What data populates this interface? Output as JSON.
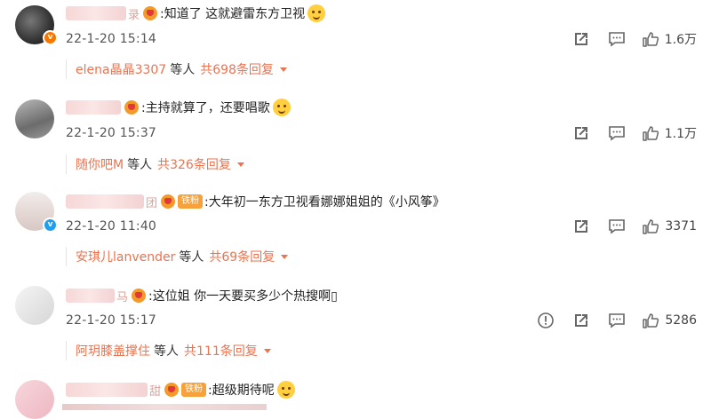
{
  "comments": [
    {
      "name_tail": "录",
      "tag": "",
      "text": ":知道了 这就避雷东方卫视",
      "time": "22-1-20 15:14",
      "likes": "1.6万",
      "reply_user": "elena晶晶3307",
      "reply_mid": "等人",
      "reply_total": "共698条回复"
    },
    {
      "name_tail": "",
      "tag": "",
      "text": ":主持就算了，还要唱歌",
      "time": "22-1-20 15:37",
      "likes": "1.1万",
      "reply_user": "随你吧M",
      "reply_mid": "等人",
      "reply_total": "共326条回复"
    },
    {
      "name_tail": "团",
      "tag": "铁粉",
      "text": ":大年初一东方卫视看娜娜姐姐的《小风筝》",
      "time": "22-1-20 11:40",
      "likes": "3371",
      "reply_user": "安琪儿lanvender",
      "reply_mid": "等人",
      "reply_total": "共69条回复"
    },
    {
      "name_tail": "马",
      "tag": "",
      "text": ":这位姐 你一天要买多少个热搜啊▯",
      "time": "22-1-20 15:17",
      "likes": "5286",
      "reply_user": "阿玥膝盖撑住",
      "reply_mid": "等人",
      "reply_total": "共111条回复"
    },
    {
      "name_tail": "甜",
      "tag": "铁粉",
      "text": ":超级期待呢"
    }
  ],
  "icons": {
    "share": "share-icon",
    "comment": "comment-icon",
    "like": "thumbs-up-icon",
    "report": "report-icon"
  },
  "colors": {
    "link": "#eb7350",
    "badge_orange": "#f77800",
    "badge_blue": "#1e9ff2",
    "tag": "#f7a13a"
  }
}
